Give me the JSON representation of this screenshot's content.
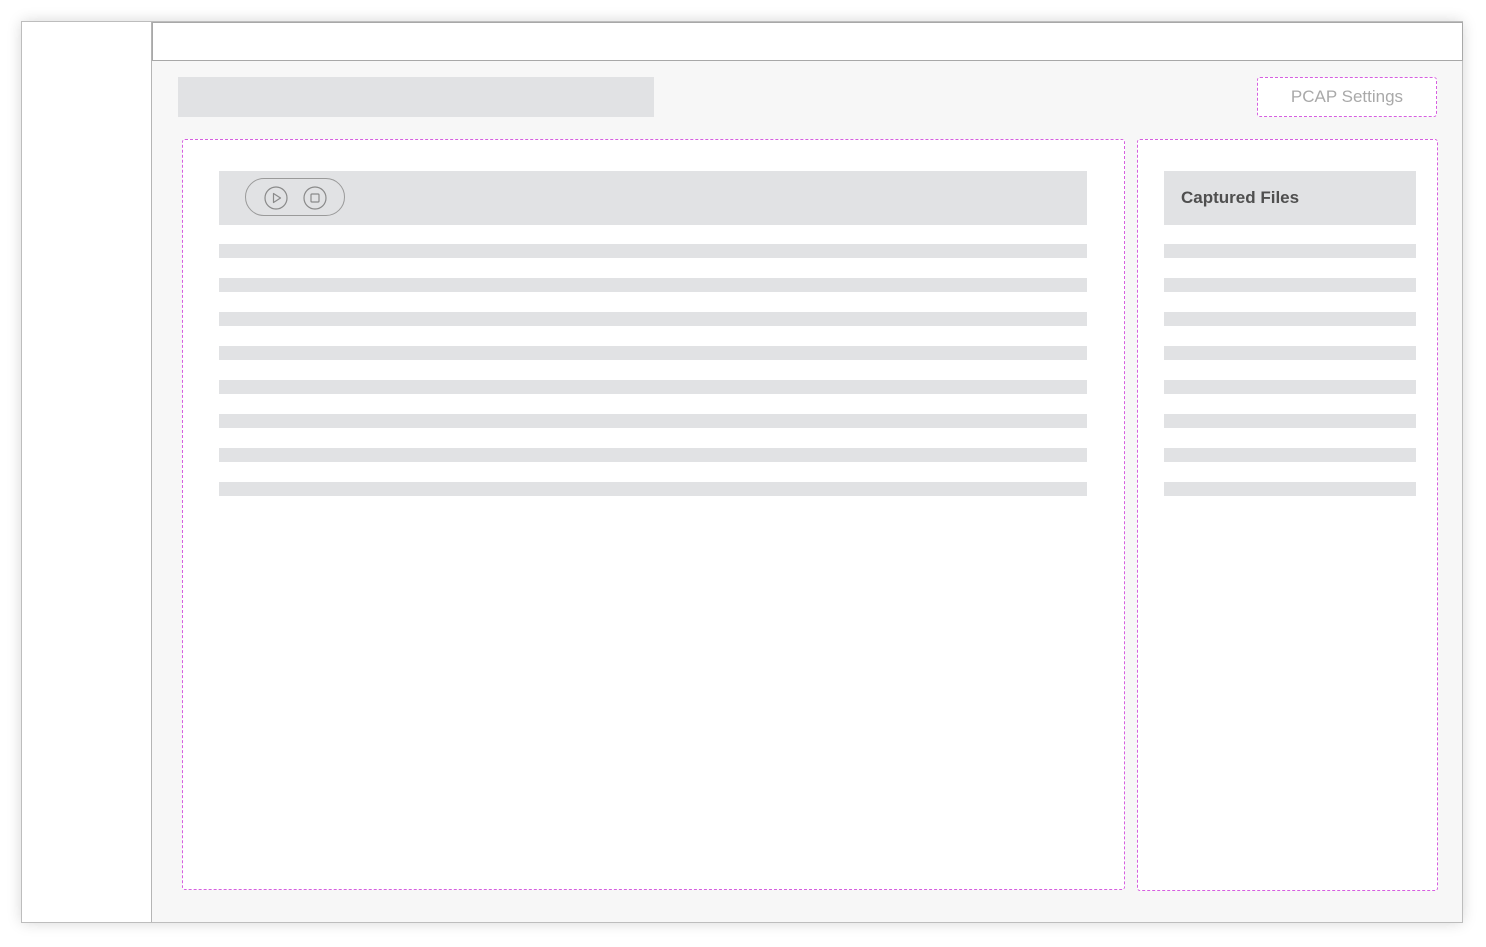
{
  "header": {
    "pcap_settings_label": "PCAP Settings"
  },
  "capture": {
    "controls": [
      {
        "name": "play",
        "icon": "play-icon"
      },
      {
        "name": "stop",
        "icon": "stop-icon"
      }
    ],
    "placeholder_rows": 8
  },
  "files": {
    "title": "Captured Files",
    "placeholder_rows": 8
  },
  "colors": {
    "dashed_outline": "#d65fe0",
    "placeholder_gray": "#e1e2e4",
    "page_background": "#f7f7f7"
  }
}
